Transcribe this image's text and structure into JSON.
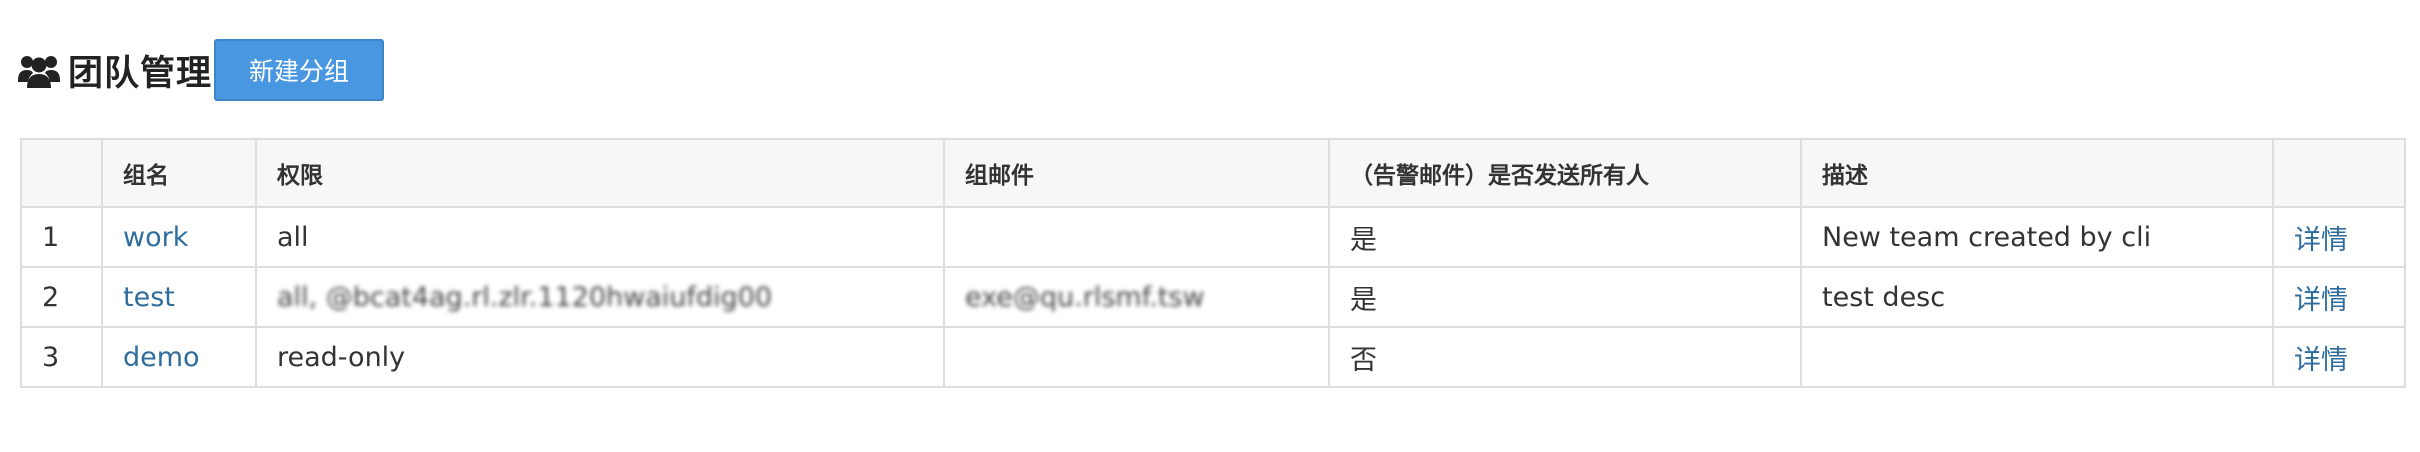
{
  "header": {
    "title": "团队管理",
    "new_group_label": "新建分组"
  },
  "table": {
    "columns": [
      "",
      "组名",
      "权限",
      "组邮件",
      "（告警邮件）是否发送所有人",
      "描述",
      ""
    ],
    "rows": [
      {
        "index": "1",
        "name": "work",
        "permission": "all",
        "email": "",
        "send_all": "是",
        "description": "New team created by cli",
        "action": "详情"
      },
      {
        "index": "2",
        "name": "test",
        "permission": "all, @bcat4ag.rl.zlr.1120hwaiufdig00",
        "email": "exe@qu.rlsmf.tsw",
        "send_all": "是",
        "description": "test desc",
        "action": "详情"
      },
      {
        "index": "3",
        "name": "demo",
        "permission": "read-only",
        "email": "",
        "send_all": "否",
        "description": "",
        "action": "详情"
      }
    ]
  },
  "icons": {
    "title_icon": "users-icon"
  },
  "colors": {
    "button_bg": "#4a97e1",
    "link": "#2f6d9e",
    "header_bg": "#f7f7f7",
    "border": "#dddddd"
  }
}
